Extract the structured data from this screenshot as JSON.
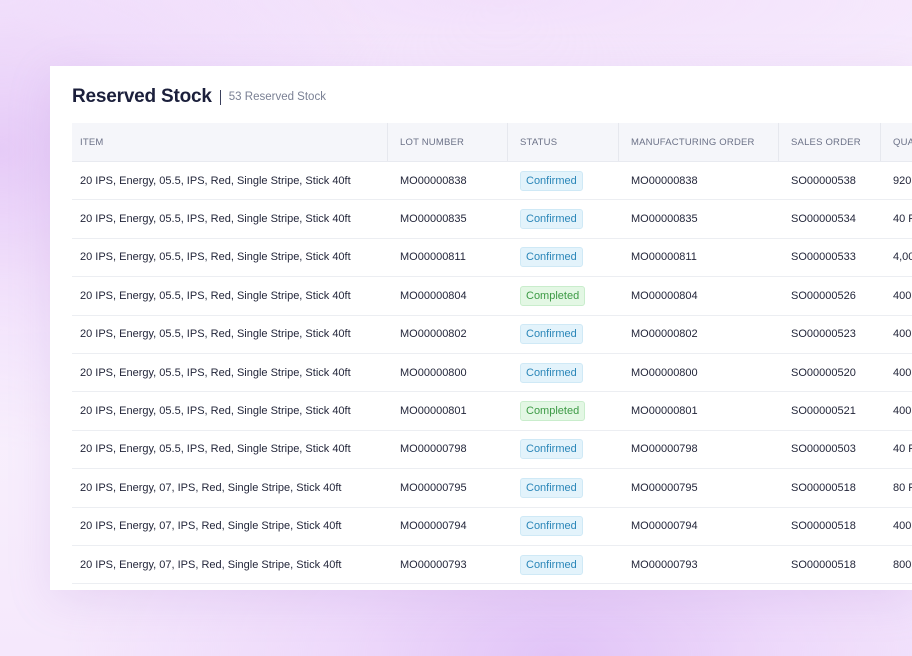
{
  "header": {
    "title": "Reserved Stock",
    "count_label": "53 Reserved Stock"
  },
  "table": {
    "columns": [
      "ITEM",
      "LOT NUMBER",
      "STATUS",
      "MANUFACTURING ORDER",
      "SALES ORDER",
      "QUA"
    ],
    "rows": [
      {
        "item": "20 IPS, Energy, 05.5, IPS, Red, Single Stripe, Stick 40ft",
        "lot": "MO00000838",
        "status": "Confirmed",
        "mo": "MO00000838",
        "so": "SO00000538",
        "qty": "920"
      },
      {
        "item": "20 IPS, Energy, 05.5, IPS, Red, Single Stripe, Stick 40ft",
        "lot": "MO00000835",
        "status": "Confirmed",
        "mo": "MO00000835",
        "so": "SO00000534",
        "qty": "40 F"
      },
      {
        "item": "20 IPS, Energy, 05.5, IPS, Red, Single Stripe, Stick 40ft",
        "lot": "MO00000811",
        "status": "Confirmed",
        "mo": "MO00000811",
        "so": "SO00000533",
        "qty": "4,00"
      },
      {
        "item": "20 IPS, Energy, 05.5, IPS, Red, Single Stripe, Stick 40ft",
        "lot": "MO00000804",
        "status": "Completed",
        "mo": "MO00000804",
        "so": "SO00000526",
        "qty": "400"
      },
      {
        "item": "20 IPS, Energy, 05.5, IPS, Red, Single Stripe, Stick 40ft",
        "lot": "MO00000802",
        "status": "Confirmed",
        "mo": "MO00000802",
        "so": "SO00000523",
        "qty": "400"
      },
      {
        "item": "20 IPS, Energy, 05.5, IPS, Red, Single Stripe, Stick 40ft",
        "lot": "MO00000800",
        "status": "Confirmed",
        "mo": "MO00000800",
        "so": "SO00000520",
        "qty": "400"
      },
      {
        "item": "20 IPS, Energy, 05.5, IPS, Red, Single Stripe, Stick 40ft",
        "lot": "MO00000801",
        "status": "Completed",
        "mo": "MO00000801",
        "so": "SO00000521",
        "qty": "400"
      },
      {
        "item": "20 IPS, Energy, 05.5, IPS, Red, Single Stripe, Stick 40ft",
        "lot": "MO00000798",
        "status": "Confirmed",
        "mo": "MO00000798",
        "so": "SO00000503",
        "qty": "40 F"
      },
      {
        "item": "20 IPS, Energy, 07, IPS, Red, Single Stripe, Stick 40ft",
        "lot": "MO00000795",
        "status": "Confirmed",
        "mo": "MO00000795",
        "so": "SO00000518",
        "qty": "80 F"
      },
      {
        "item": "20 IPS, Energy, 07, IPS, Red, Single Stripe, Stick 40ft",
        "lot": "MO00000794",
        "status": "Confirmed",
        "mo": "MO00000794",
        "so": "SO00000518",
        "qty": "400"
      },
      {
        "item": "20 IPS, Energy, 07, IPS, Red, Single Stripe, Stick 40ft",
        "lot": "MO00000793",
        "status": "Confirmed",
        "mo": "MO00000793",
        "so": "SO00000518",
        "qty": "800"
      }
    ]
  },
  "colors": {
    "confirmed": "#2a86b8",
    "completed": "#3c9a45"
  }
}
